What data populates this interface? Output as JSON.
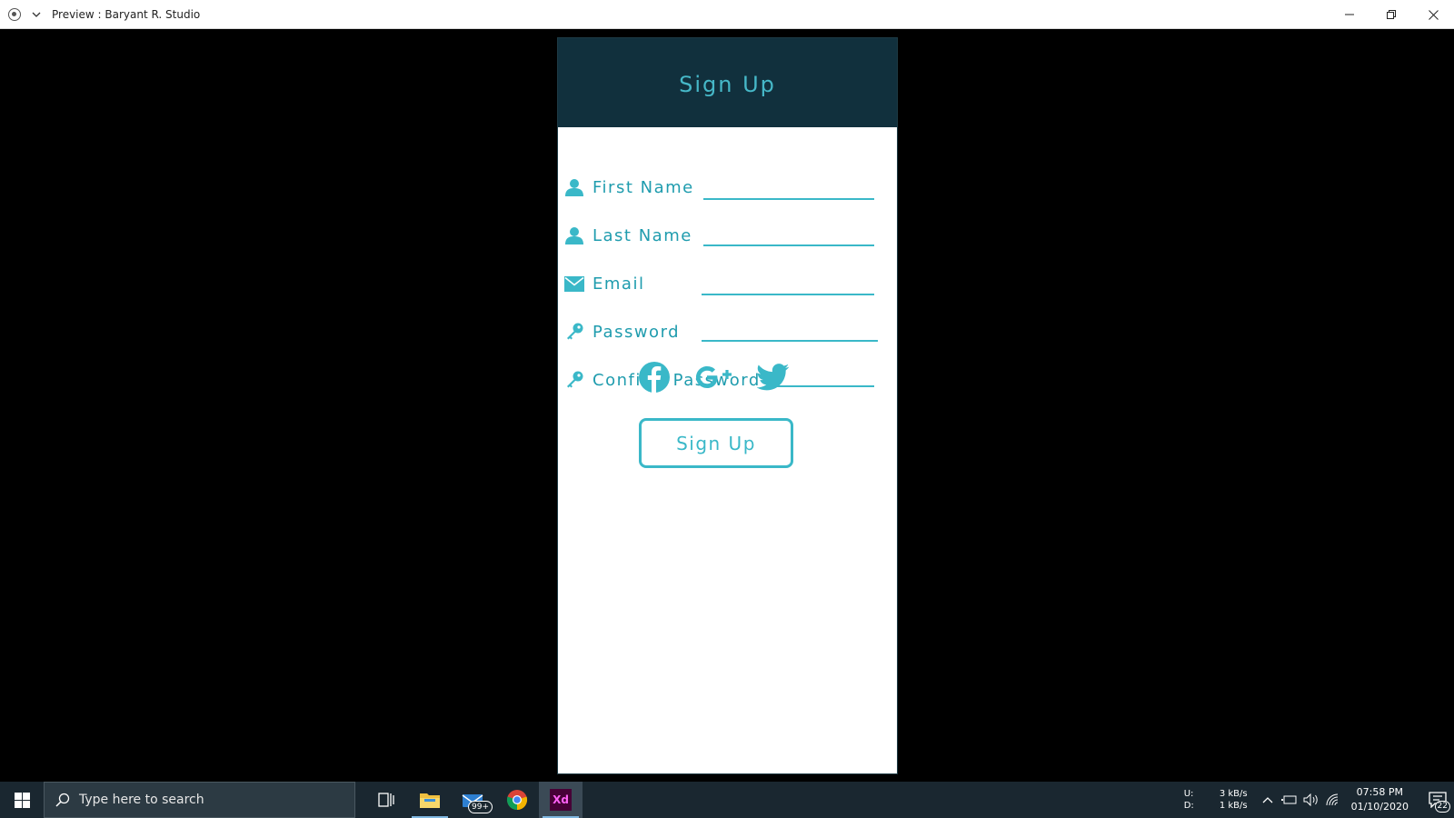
{
  "window": {
    "title": "Preview : Baryant R. Studio"
  },
  "card": {
    "title": "Sign Up",
    "header_color": "#11303d",
    "accent_color": "#3ab8c8"
  },
  "form": {
    "fields": [
      {
        "label": "First Name",
        "icon": "user-icon"
      },
      {
        "label": "Last Name",
        "icon": "user-icon"
      },
      {
        "label": "Email",
        "icon": "envelope-icon"
      },
      {
        "label": "Password",
        "icon": "key-icon"
      },
      {
        "label": "Confirm Password",
        "icon": "key-icon"
      }
    ]
  },
  "social": [
    "facebook-icon",
    "google-plus-icon",
    "twitter-icon"
  ],
  "button": {
    "signup_label": "Sign Up"
  },
  "taskbar": {
    "search_placeholder": "Type here to search",
    "mail_badge": "99+",
    "xd_label": "Xd",
    "net_upload_label": "U:",
    "net_download_label": "D:",
    "net_upload": "3 kB/s",
    "net_download": "1 kB/s",
    "time": "07:58 PM",
    "date": "01/10/2020",
    "notifications": "22"
  }
}
